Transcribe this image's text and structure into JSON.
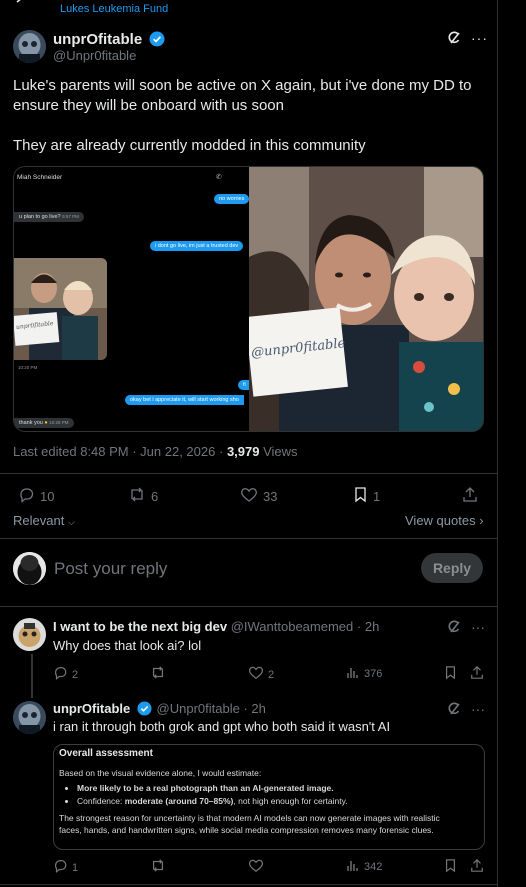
{
  "header": {
    "community_link": "Lukes Leukemia Fund"
  },
  "post": {
    "display_name": "unprOfitable",
    "handle": "@Unpr0fitable",
    "text_line1": "Luke's parents will soon be active on X again, but i've done my DD to",
    "text_line2": "ensure they will be onboard with us soon",
    "text_line3": "They are already currently modded in this community",
    "meta_time": "Last edited 8:48 PM · Jun 22, 2026 ·",
    "views_count": "3,979",
    "views_label": "Views",
    "replies": "10",
    "reposts": "6",
    "likes": "33",
    "bookmarks": "1",
    "relevant_label": "Relevant",
    "view_quotes_label": "View quotes",
    "screenshot": {
      "contact_name": "Miah Schneider",
      "msg_no_worries": "no worries",
      "msg_plan_golive": "u plan to go live?",
      "time1": "9:57 PM",
      "msg_trusted_dev": "i dont go live, im just a trusted dev",
      "sign_text_small": "unpr0fitable",
      "time2": "10:20 PM",
      "msg_fi": "fi",
      "msg_okay_bet": "okay bet i appreciate it, will start working sho",
      "msg_thank_you": "thank you",
      "time3": "10:28 PM"
    },
    "photo_sign_text": "@unpr0fitable"
  },
  "reply_box": {
    "placeholder": "Post your reply",
    "button": "Reply"
  },
  "replies": [
    {
      "display_name": "I want to be the next big dev",
      "handle": "@IWanttobeamemed",
      "time": "2h",
      "text": "Why does that look ai? lol",
      "replies": "2",
      "reposts": "",
      "likes": "2",
      "views": "376"
    },
    {
      "display_name": "unprOfitable",
      "handle": "@Unpr0fitable",
      "time": "2h",
      "text": "i ran it through both grok and gpt who both said it wasn't AI",
      "replies": "1",
      "reposts": "",
      "likes": "",
      "views": "342",
      "assessment": {
        "title": "Overall assessment",
        "intro": "Based on the visual evidence alone, I would estimate:",
        "bullet1": "More likely to be a real photograph than an AI-generated image.",
        "bullet2_label": "Confidence: ",
        "bullet2_value": "moderate (around 70–85%)",
        "bullet2_rest": ", not high enough for certainty.",
        "body1": "The strongest reason for uncertainty is that modern AI models can now generate images with realistic",
        "body2": "faces, hands, and handwritten signs, while social media compression removes many forensic clues."
      }
    }
  ],
  "colors": {
    "accent": "#1d9bf0",
    "border": "#2f3336",
    "muted": "#71767b"
  }
}
